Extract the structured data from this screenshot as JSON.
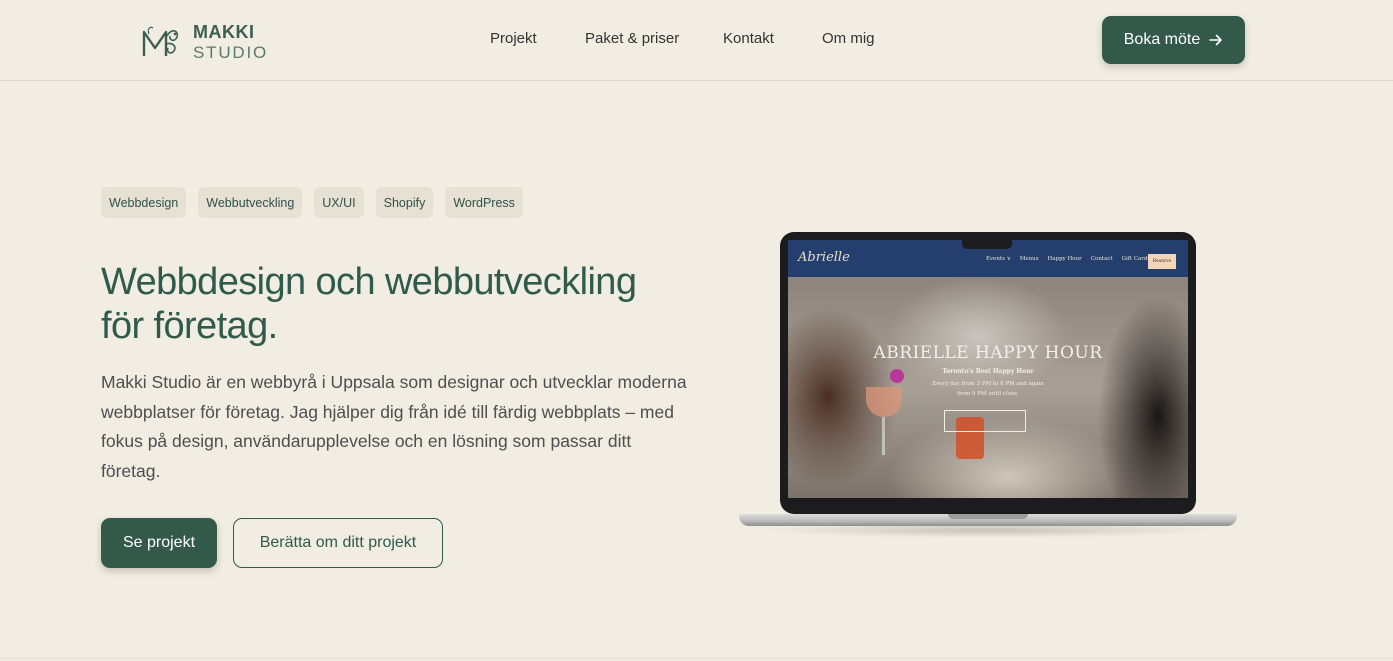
{
  "brand": {
    "name_top": "MAKKI",
    "name_bottom": "STUDIO"
  },
  "nav": {
    "items": [
      "Projekt",
      "Paket & priser",
      "Kontakt",
      "Om mig"
    ]
  },
  "header_cta": {
    "label": "Boka möte"
  },
  "tags": [
    "Webbdesign",
    "Webbutveckling",
    "UX/UI",
    "Shopify",
    "WordPress"
  ],
  "hero": {
    "headline": "Webbdesign och webbutveckling för företag.",
    "intro": "Makki Studio är en webbyrå i Uppsala som designar och utvecklar moderna webbplatser för företag. Jag hjälper dig från idé till färdig webbplats – med fokus på design, användarupplevelse och en lösning som passar ditt företag.",
    "primary_button": "Se projekt",
    "secondary_button": "Berätta om ditt projekt"
  },
  "mockup": {
    "site_logo": "Abrielle",
    "site_nav": [
      "Events ∨",
      "Menus",
      "Happy Hour",
      "Contact",
      "Gift Cards"
    ],
    "site_reserve": "Reserve",
    "site_title": "ABRIELLE HAPPY HOUR",
    "site_subtitle": "Toronto's Best Happy Hour",
    "site_text": "Every day from 3 PM to 6 PM and again from 9 PM until close."
  },
  "colors": {
    "background": "#f2ede3",
    "accent": "#33594b",
    "headline": "#2f5a4c",
    "tag_bg": "#e6e1d4"
  }
}
